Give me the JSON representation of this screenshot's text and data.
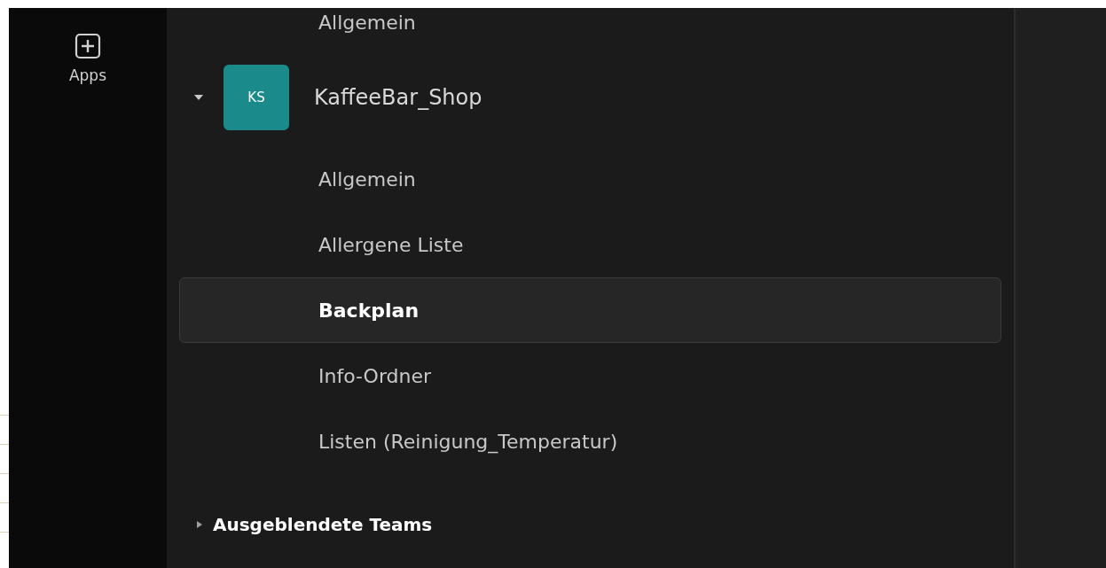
{
  "app_rail": {
    "apps_button": {
      "label": "Apps"
    }
  },
  "sidebar": {
    "previous_team_channels": [
      {
        "label": "Allgemein",
        "selected": false
      }
    ],
    "teams": [
      {
        "name": "KaffeeBar_Shop",
        "initials": "KS",
        "color": "#1a8a8a",
        "expanded": true,
        "channels": [
          {
            "label": "Allgemein",
            "selected": false
          },
          {
            "label": "Allergene Liste",
            "selected": false
          },
          {
            "label": "Backplan",
            "selected": true
          },
          {
            "label": "Info-Ordner",
            "selected": false
          },
          {
            "label": "Listen (Reinigung_Temperatur)",
            "selected": false
          }
        ]
      }
    ],
    "hidden_teams": {
      "label": "Ausgeblendete Teams",
      "expanded": false
    }
  }
}
